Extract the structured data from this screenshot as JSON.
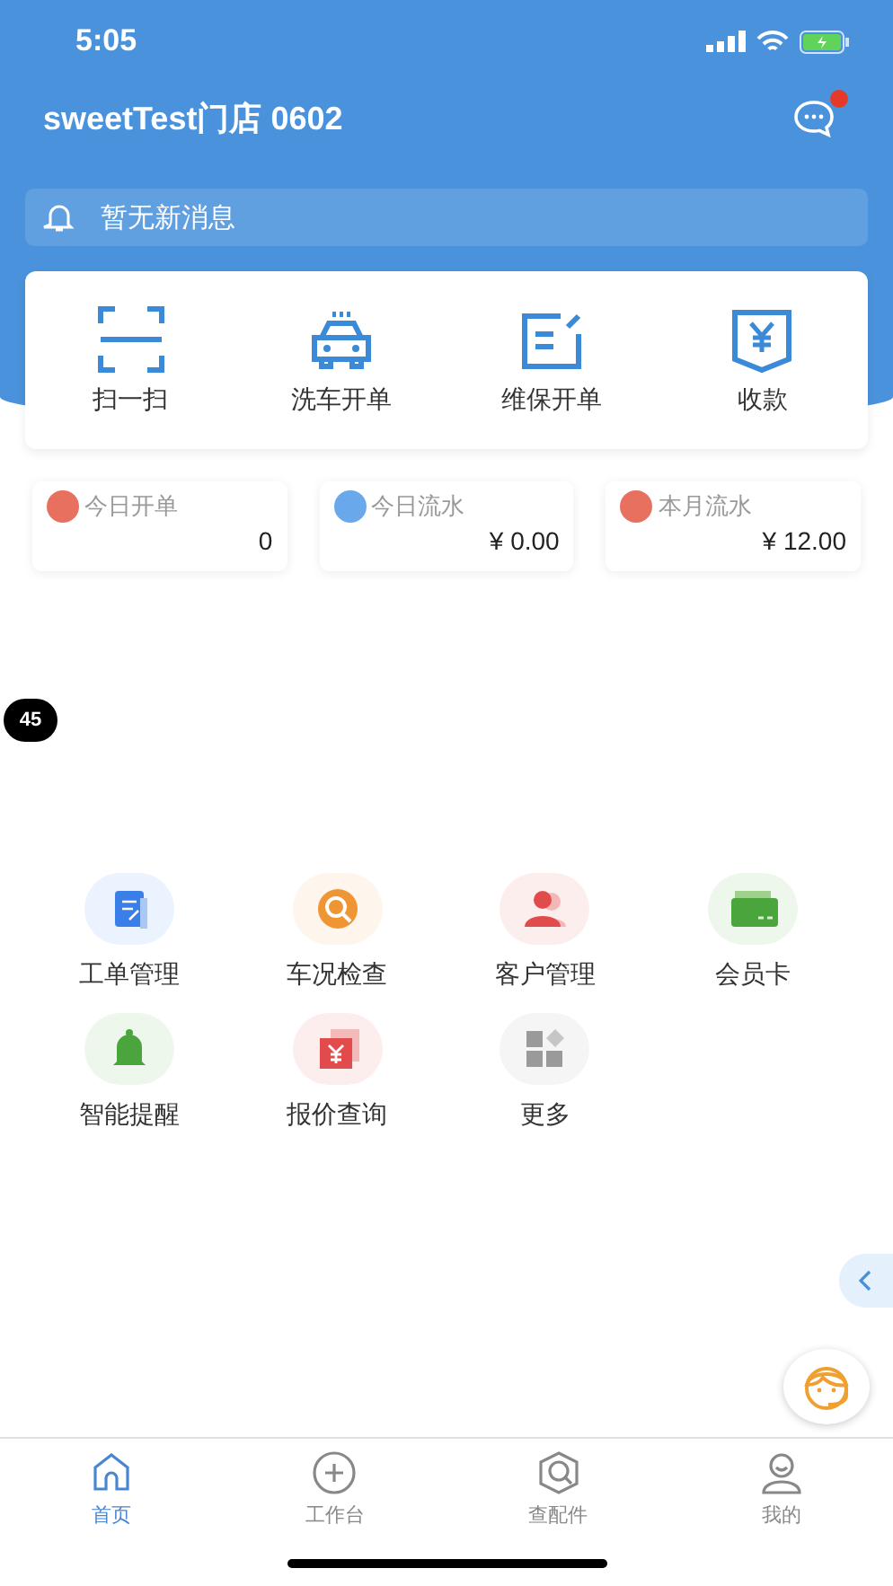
{
  "status_bar": {
    "time": "5:05"
  },
  "header": {
    "store_name": "sweetTest门店 0602",
    "messages_unread": true
  },
  "notice": {
    "text": "暂无新消息"
  },
  "quick_actions": [
    {
      "label": "扫一扫"
    },
    {
      "label": "洗车开单"
    },
    {
      "label": "维保开单"
    },
    {
      "label": "收款"
    }
  ],
  "stats": [
    {
      "label": "今日开单",
      "value": "0",
      "color": "#e8705e"
    },
    {
      "label": "今日流水",
      "value": "¥ 0.00",
      "color": "#6aa8ec"
    },
    {
      "label": "本月流水",
      "value": "¥ 12.00",
      "color": "#e8705e"
    }
  ],
  "floating_badge": "45",
  "features": [
    {
      "label": "工单管理"
    },
    {
      "label": "车况检查"
    },
    {
      "label": "客户管理"
    },
    {
      "label": "会员卡"
    },
    {
      "label": "智能提醒"
    },
    {
      "label": "报价查询"
    },
    {
      "label": "更多"
    }
  ],
  "tab_bar": [
    {
      "label": "首页",
      "selected": true
    },
    {
      "label": "工作台",
      "selected": false
    },
    {
      "label": "查配件",
      "selected": false
    },
    {
      "label": "我的",
      "selected": false
    }
  ]
}
